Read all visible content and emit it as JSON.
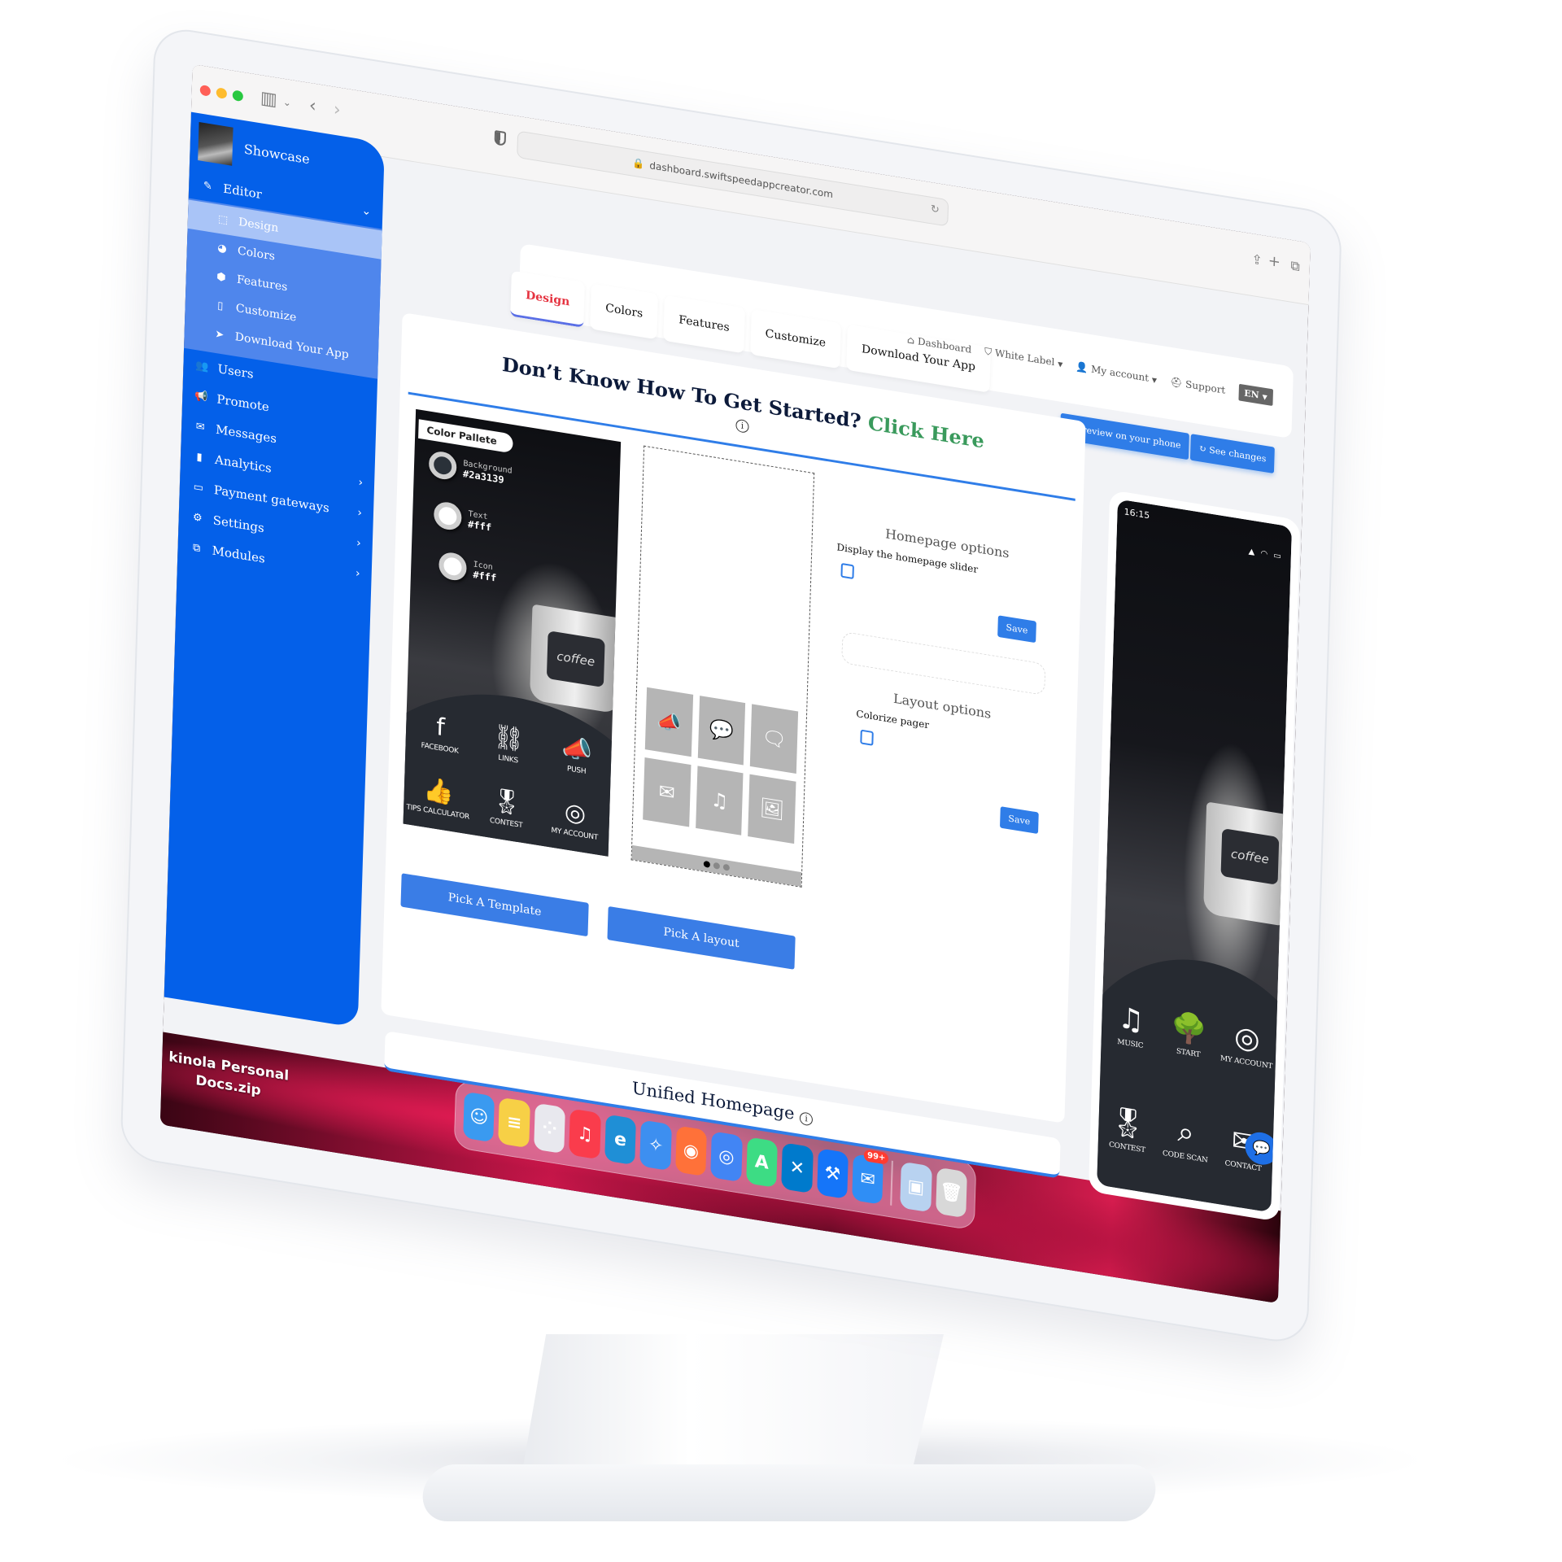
{
  "browser": {
    "url": "dashboard.swiftspeedappcreator.com",
    "traffic_lights": {
      "close": "#ff5f57",
      "minimize": "#febc2e",
      "zoom": "#28c840"
    },
    "toolbar_icons": [
      "sidebar-toggle-icon",
      "chevron-down-icon",
      "back-icon",
      "forward-icon",
      "share-icon",
      "new-tab-icon",
      "tabs-overview-icon"
    ]
  },
  "sidebar": {
    "app_name": "Showcase",
    "editor": {
      "label": "Editor",
      "icon": "✎"
    },
    "sub_items": [
      {
        "label": "Design",
        "icon": "⬚",
        "active": true
      },
      {
        "label": "Colors",
        "icon": "◕"
      },
      {
        "label": "Features",
        "icon": "⬢"
      },
      {
        "label": "Customize",
        "icon": "▯"
      },
      {
        "label": "Download Your App",
        "icon": "➤"
      }
    ],
    "items": [
      {
        "label": "Users",
        "icon": "👥",
        "chevron": false
      },
      {
        "label": "Promote",
        "icon": "📢",
        "chevron": false
      },
      {
        "label": "Messages",
        "icon": "✉",
        "chevron": false
      },
      {
        "label": "Analytics",
        "icon": "▮",
        "chevron": true
      },
      {
        "label": "Payment gateways",
        "icon": "▭",
        "chevron": true
      },
      {
        "label": "Settings",
        "icon": "⚙",
        "chevron": true
      },
      {
        "label": "Modules",
        "icon": "⧉",
        "chevron": true
      }
    ]
  },
  "tabs": [
    {
      "label": "Design",
      "active": true
    },
    {
      "label": "Colors"
    },
    {
      "label": "Features"
    },
    {
      "label": "Customize"
    },
    {
      "label": "Download Your App"
    }
  ],
  "topnav": {
    "dashboard": "Dashboard",
    "white_label": "White Label",
    "my_account": "My account",
    "support": "Support",
    "language": "EN"
  },
  "actions": {
    "preview": "Preview on your phone",
    "see_changes": "See changes"
  },
  "headline": {
    "text": "Don’t Know How To Get Started?",
    "cta": "Click Here"
  },
  "template_preview": {
    "palette_title": "Color Pallete",
    "palette": [
      {
        "name": "Background",
        "value": "#2a3139",
        "swatch": "#2a3139"
      },
      {
        "name": "Text",
        "value": "#fff",
        "swatch": "#ffffff"
      },
      {
        "name": "Icon",
        "value": "#fff",
        "swatch": "#ffffff"
      }
    ],
    "mug_text": "coffee",
    "icons": [
      {
        "label": "FACEBOOK",
        "glyph": "f"
      },
      {
        "label": "LINKS",
        "glyph": "⛓"
      },
      {
        "label": "PUSH",
        "glyph": "📣"
      },
      {
        "label": "TIPS CALCULATOR",
        "glyph": "👍"
      },
      {
        "label": "CONTEST",
        "glyph": "🎖"
      },
      {
        "label": "MY ACCOUNT",
        "glyph": "◎"
      }
    ]
  },
  "layout_preview": {
    "tiles": [
      "📣",
      "💬",
      "🗨",
      "✉",
      "♫",
      "🖼"
    ],
    "pager": {
      "pages": 3,
      "current": 1
    }
  },
  "homepage_options": {
    "title": "Homepage options",
    "slider_label": "Display the homepage slider",
    "slider_checked": false,
    "save": "Save"
  },
  "layout_options": {
    "title": "Layout options",
    "colorize_label": "Colorize pager",
    "colorize_checked": false,
    "save": "Save"
  },
  "buttons": {
    "pick_template": "Pick A Template",
    "pick_layout": "Pick A layout"
  },
  "unified": {
    "title": "Unified Homepage"
  },
  "phone_preview": {
    "time": "16:15",
    "status_icons": "▲ ◠ ▭",
    "mug_text": "coffee",
    "icons": [
      {
        "label": "MUSIC",
        "glyph": "♫"
      },
      {
        "label": "START",
        "glyph": "🌳"
      },
      {
        "label": "MY ACCOUNT",
        "glyph": "◎"
      },
      {
        "label": "CONTEST",
        "glyph": "🎖"
      },
      {
        "label": "CODE SCAN",
        "glyph": "⌕"
      },
      {
        "label": "CONTACT",
        "glyph": "✉"
      }
    ]
  },
  "desktop": {
    "file_line1": "kinola Personal",
    "file_line2": "Docs.zip",
    "dock": [
      {
        "name": "Finder",
        "color": "#3a9af0",
        "glyph": "☺"
      },
      {
        "name": "Notes",
        "color": "#f7d046",
        "glyph": "≡"
      },
      {
        "name": "Launchpad",
        "color": "#e8e8ee",
        "glyph": "⁘"
      },
      {
        "name": "Music",
        "color": "#fa3c4c",
        "glyph": "♫"
      },
      {
        "name": "Edge",
        "color": "#1f8fd6",
        "glyph": "e"
      },
      {
        "name": "Safari",
        "color": "#3d8ff0",
        "glyph": "✧"
      },
      {
        "name": "Firefox",
        "color": "#ff7139",
        "glyph": "◉"
      },
      {
        "name": "Chrome",
        "color": "#4285f4",
        "glyph": "◎"
      },
      {
        "name": "Android Studio",
        "color": "#3ddc84",
        "glyph": "A"
      },
      {
        "name": "VS Code",
        "color": "#007acc",
        "glyph": "✕"
      },
      {
        "name": "Xcode",
        "color": "#1575f9",
        "glyph": "⚒"
      },
      {
        "name": "Mail",
        "color": "#2f8ef5",
        "glyph": "✉",
        "badge": "99+"
      },
      {
        "name": "Preview",
        "color": "#b8d2f0",
        "glyph": "▣"
      },
      {
        "name": "Trash",
        "color": "#d8d8d8",
        "glyph": "🗑"
      }
    ]
  }
}
